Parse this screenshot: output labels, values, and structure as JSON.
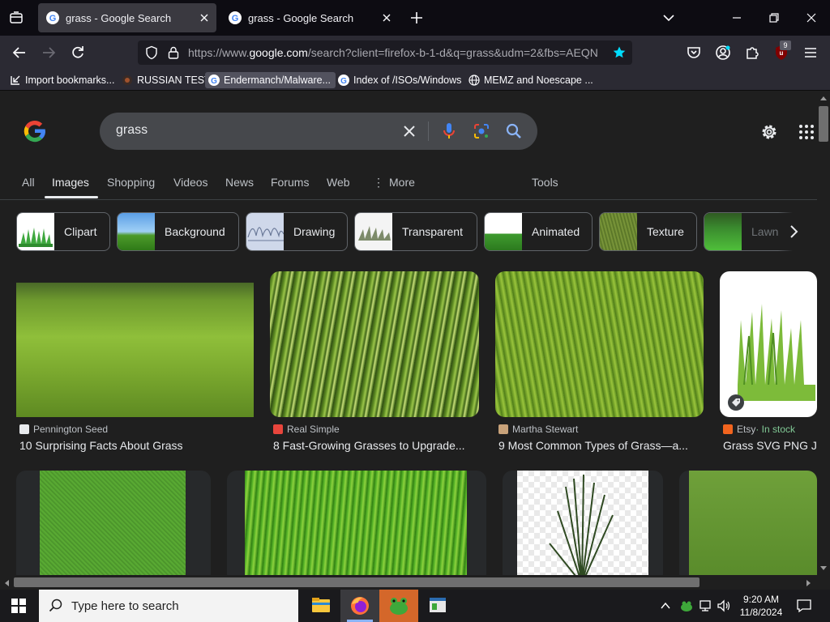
{
  "browser": {
    "tabs": [
      {
        "title": "grass - Google Search",
        "active": true
      },
      {
        "title": "grass - Google Search",
        "active": false
      }
    ],
    "url": {
      "prefix": "https://www.",
      "domain": "google.com",
      "rest": "/search?client=firefox-b-1-d&q=grass&udm=2&fbs=AEQN"
    },
    "bookmarks": [
      {
        "label": "Import bookmarks..."
      },
      {
        "label": "RUSSIAN TEST"
      },
      {
        "label": "Endermanch/Malware..."
      },
      {
        "label": "Index of /ISOs/Windows"
      },
      {
        "label": "MEMZ and Noescape ..."
      }
    ],
    "extension_badge": "9"
  },
  "google": {
    "query": "grass",
    "tabs": [
      "All",
      "Images",
      "Shopping",
      "Videos",
      "News",
      "Forums",
      "Web",
      "More",
      "Tools"
    ],
    "active_tab": "Images",
    "chips": [
      "Clipart",
      "Background",
      "Drawing",
      "Transparent",
      "Animated",
      "Texture",
      "Lawn"
    ],
    "results": [
      {
        "source": "Pennington Seed",
        "title": "10 Surprising Facts About Grass"
      },
      {
        "source": "Real Simple",
        "title": "8 Fast-Growing Grasses to Upgrade..."
      },
      {
        "source": "Martha Stewart",
        "title": "9 Most Common Types of Grass—a..."
      },
      {
        "source": "Etsy",
        "badge": " · In stock",
        "title": "Grass SVG PNG J..."
      }
    ]
  },
  "taskbar": {
    "search_placeholder": "Type here to search",
    "time": "9:20 AM",
    "date": "11/8/2024"
  },
  "colors": {
    "accent_blue": "#8ab4f8",
    "in_stock_green": "#81c995",
    "bookmark_star": "#00ddff"
  }
}
